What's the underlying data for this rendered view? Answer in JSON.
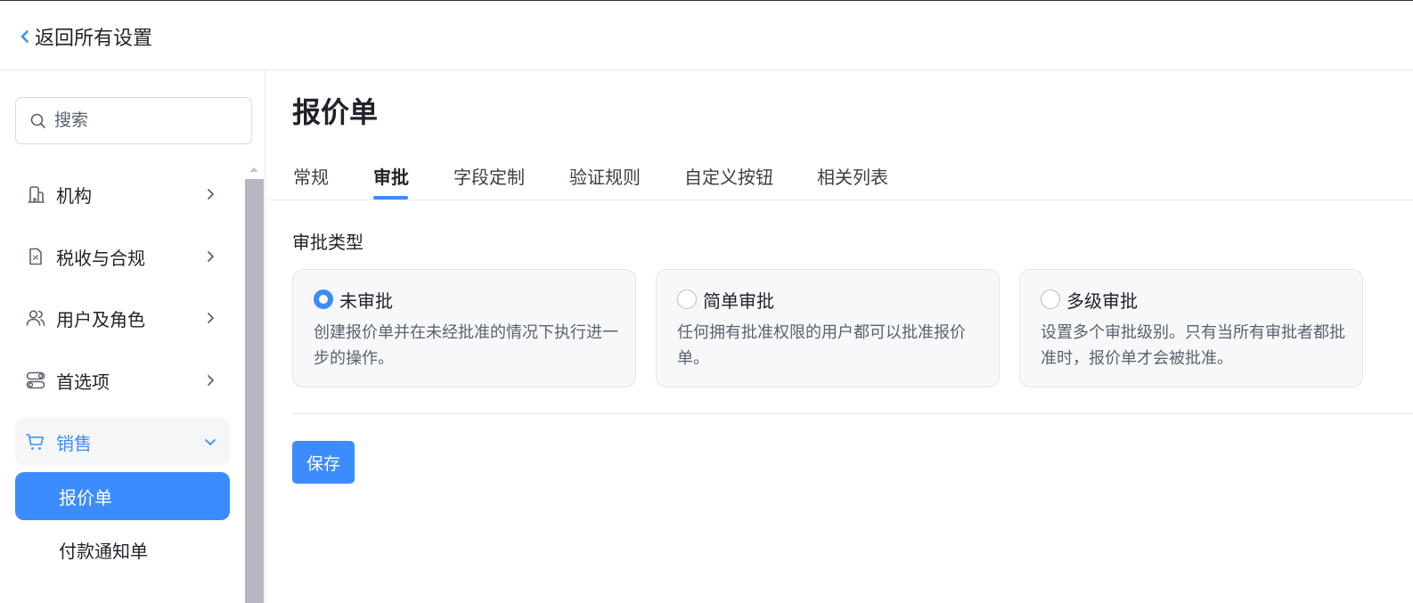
{
  "header": {
    "back_label": "返回所有设置"
  },
  "search": {
    "placeholder": "搜索"
  },
  "sidebar": {
    "items": [
      {
        "label": "机构",
        "icon": "building-icon"
      },
      {
        "label": "税收与合规",
        "icon": "tax-document-icon"
      },
      {
        "label": "用户及角色",
        "icon": "users-icon"
      },
      {
        "label": "首选项",
        "icon": "preferences-icon"
      },
      {
        "label": "销售",
        "icon": "cart-icon",
        "expanded": true
      }
    ],
    "sub_items": [
      {
        "label": "报价单",
        "active": true
      },
      {
        "label": "付款通知单"
      }
    ]
  },
  "main": {
    "title": "报价单",
    "tabs": [
      {
        "label": "常规"
      },
      {
        "label": "审批",
        "active": true
      },
      {
        "label": "字段定制"
      },
      {
        "label": "验证规则"
      },
      {
        "label": "自定义按钮"
      },
      {
        "label": "相关列表"
      }
    ],
    "section_label": "审批类型",
    "options": [
      {
        "title": "未审批",
        "description": "创建报价单并在未经批准的情况下执行进一步的操作。",
        "selected": true
      },
      {
        "title": "简单审批",
        "description": "任何拥有批准权限的用户都可以批准报价单。",
        "selected": false
      },
      {
        "title": "多级审批",
        "description": "设置多个审批级别。只有当所有审批者都批准时，报价单才会被批准。",
        "selected": false
      }
    ],
    "save_label": "保存"
  },
  "colors": {
    "accent": "#3c8cff",
    "text": "#1f2329",
    "muted": "#5b6270",
    "card_bg": "#f7f8fa",
    "scrollbar": "#b7b6c1"
  }
}
